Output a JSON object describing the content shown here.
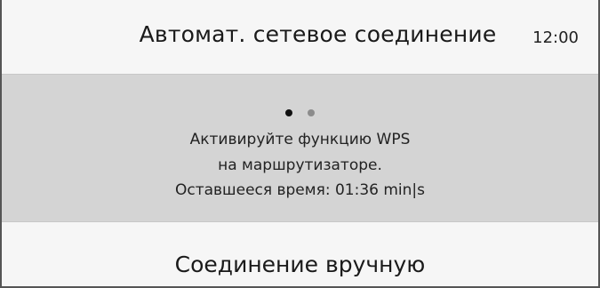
{
  "header": {
    "title": "Автомат. сетевое соединение",
    "clock": "12:00"
  },
  "panel": {
    "step_indicator": {
      "total": 2,
      "current": 1
    },
    "line1": "Активируйте функцию WPS",
    "line2": "на маршрутизаторе.",
    "line3": "Оставшееся время:  01:36 min|s"
  },
  "footer": {
    "manual_label": "Соединение вручную"
  },
  "colors": {
    "background": "#f6f6f6",
    "panel": "#d4d4d4",
    "dot_active": "#111111",
    "dot_inactive": "#8c8c8c",
    "frame": "#555555"
  }
}
